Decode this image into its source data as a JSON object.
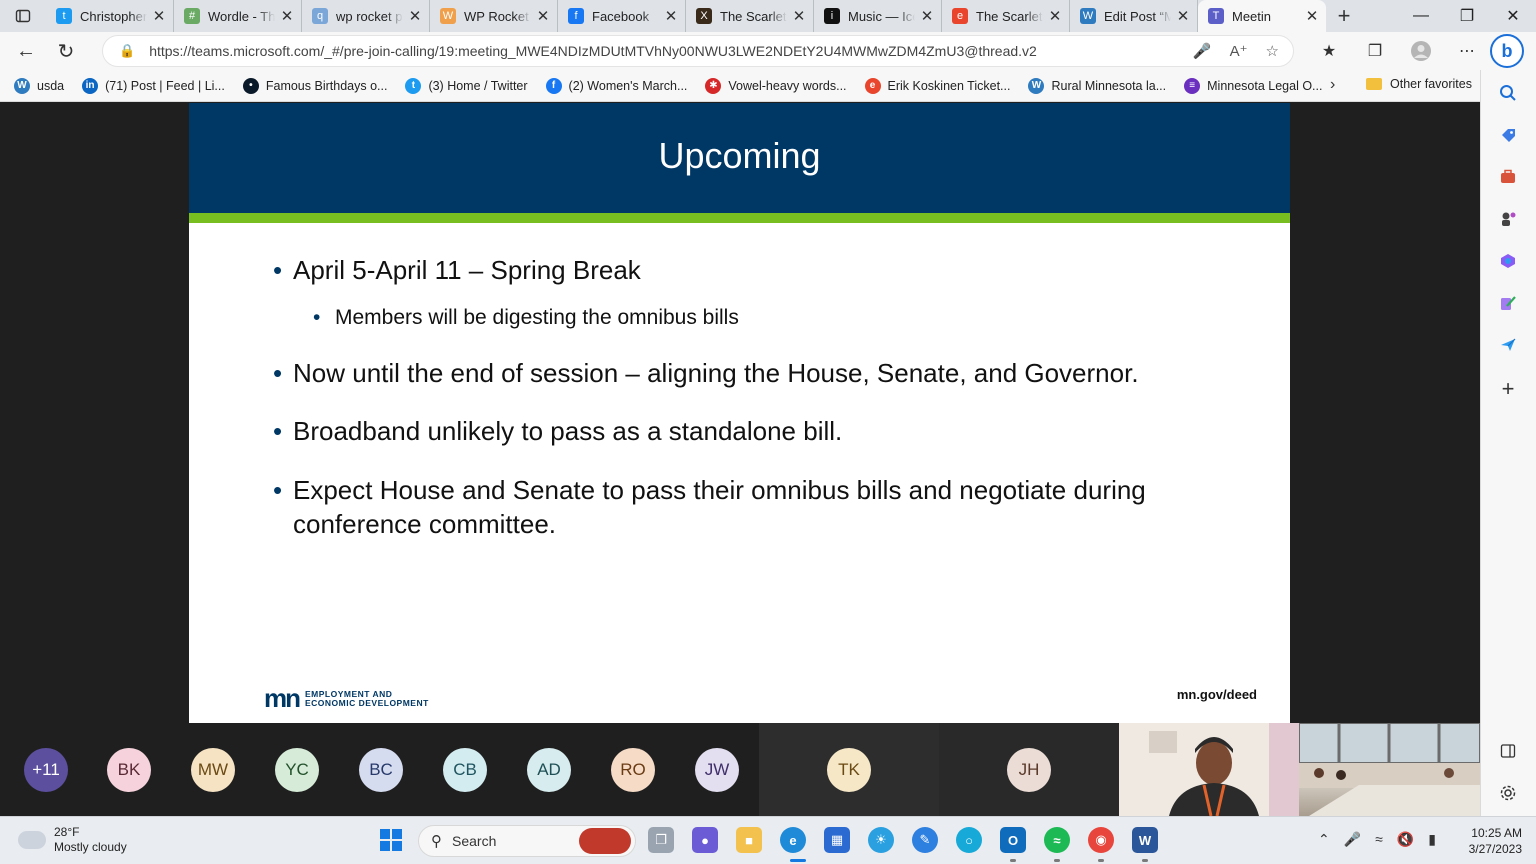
{
  "browser": {
    "tabs": [
      {
        "title": "Christopher",
        "fav": "twitter-bird",
        "color": "#1d9bf0",
        "glyph": "t"
      },
      {
        "title": "Wordle - Th",
        "fav": "grid",
        "color": "#6aaa64",
        "glyph": "#"
      },
      {
        "title": "wp rocket p",
        "fav": "search",
        "color": "#7aa6d8",
        "glyph": "q"
      },
      {
        "title": "WP Rocket",
        "fav": "rocket",
        "color": "#f0a04b",
        "glyph": "W"
      },
      {
        "title": "Facebook",
        "fav": "facebook",
        "color": "#1877f2",
        "glyph": "f"
      },
      {
        "title": "The Scarlet",
        "fav": "x-logo",
        "color": "#3a2a1a",
        "glyph": "X"
      },
      {
        "title": "Music — Ice",
        "fav": "info",
        "color": "#111111",
        "glyph": "i"
      },
      {
        "title": "The Scarlet",
        "fav": "e-logo",
        "color": "#e8452c",
        "glyph": "e"
      },
      {
        "title": "Edit Post “M",
        "fav": "wordpress",
        "color": "#2f7bbf",
        "glyph": "W"
      },
      {
        "title": "Meetin",
        "fav": "teams",
        "color": "#5b5fc7",
        "glyph": "T"
      }
    ],
    "url": "https://teams.microsoft.com/_#/pre-join-calling/19:meeting_MWE4NDIzMDUtMTVhNy00NWU3LWE2NDEtY2U4MWMwZDM4ZmU3@thread.v2",
    "favorites": [
      {
        "label": "usda",
        "color": "#2f7bbf",
        "glyph": "W"
      },
      {
        "label": "(71) Post | Feed | Li...",
        "color": "#0a66c2",
        "glyph": "in"
      },
      {
        "label": "Famous Birthdays o...",
        "color": "#0b1a2a",
        "glyph": "•"
      },
      {
        "label": "(3) Home / Twitter",
        "color": "#1d9bf0",
        "glyph": "t"
      },
      {
        "label": "(2) Women's March...",
        "color": "#1877f2",
        "glyph": "f"
      },
      {
        "label": "Vowel-heavy words...",
        "color": "#d62828",
        "glyph": "✱"
      },
      {
        "label": "Erik Koskinen Ticket...",
        "color": "#e8452c",
        "glyph": "e"
      },
      {
        "label": "Rural Minnesota la...",
        "color": "#2f7bbf",
        "glyph": "W"
      },
      {
        "label": "Minnesota Legal O...",
        "color": "#6b2fbf",
        "glyph": "≡"
      }
    ],
    "other_favorites": "Other favorites"
  },
  "slide": {
    "title": "Upcoming",
    "bullets": [
      "April 5-April 11 – Spring Break",
      "Members will be digesting the omnibus bills",
      "Now until the end of session – aligning the House, Senate, and Governor.",
      "Broadband unlikely to pass as a standalone bill.",
      "Expect House and Senate to pass their omnibus bills and negotiate during conference committee."
    ],
    "logo_line1": "EMPLOYMENT AND",
    "logo_line2": "ECONOMIC DEVELOPMENT",
    "logo_mark": "mn",
    "footer_url": "mn.gov/deed"
  },
  "participants": [
    {
      "initials": "+11",
      "bg": "#5c4f9e",
      "fg": "#ffffff"
    },
    {
      "initials": "BK",
      "bg": "#f6d3dc",
      "fg": "#5a2a36"
    },
    {
      "initials": "MW",
      "bg": "#f6e3c3",
      "fg": "#6b4a14"
    },
    {
      "initials": "YC",
      "bg": "#d6ecd8",
      "fg": "#24522c"
    },
    {
      "initials": "BC",
      "bg": "#d6dcf0",
      "fg": "#273a6b"
    },
    {
      "initials": "CB",
      "bg": "#d3ecf0",
      "fg": "#1f5560"
    },
    {
      "initials": "AD",
      "bg": "#d6ecee",
      "fg": "#1f5056"
    },
    {
      "initials": "RO",
      "bg": "#f6dcc6",
      "fg": "#6b3b14"
    },
    {
      "initials": "JW",
      "bg": "#e3def0",
      "fg": "#3f2f6b"
    },
    {
      "initials": "TK",
      "bg": "#f6e7c6",
      "fg": "#6b4a14"
    },
    {
      "initials": "JH",
      "bg": "#ecdcd6",
      "fg": "#5a3a2a"
    }
  ],
  "taskbar": {
    "temperature": "28°F",
    "weather": "Mostly cloudy",
    "search_label": "Search",
    "time": "10:25 AM",
    "date": "3/27/2023"
  }
}
